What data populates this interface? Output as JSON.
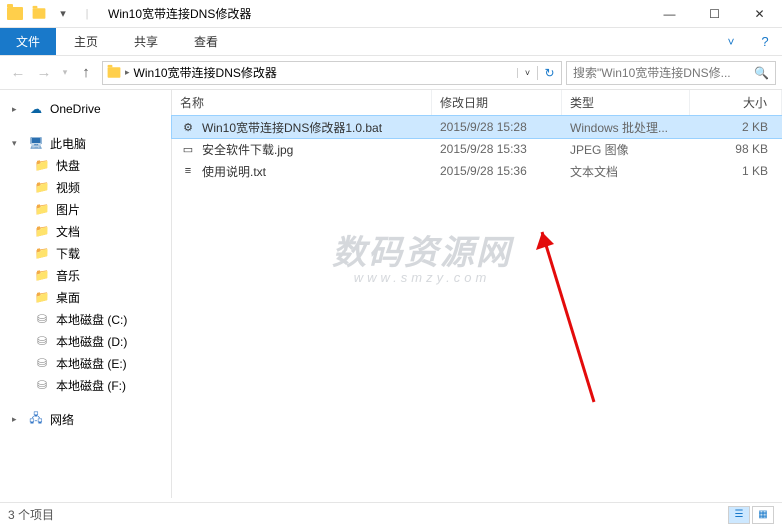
{
  "title": "Win10宽带连接DNS修改器",
  "ribbon": {
    "file": "文件",
    "tabs": [
      "主页",
      "共享",
      "查看"
    ]
  },
  "address": {
    "path": "Win10宽带连接DNS修改器"
  },
  "search": {
    "placeholder": "搜索\"Win10宽带连接DNS修..."
  },
  "navpane": {
    "onedrive": "OneDrive",
    "thispc": "此电脑",
    "children": [
      {
        "icon": "ico-green",
        "label": "快盘"
      },
      {
        "icon": "ico-video",
        "label": "视频"
      },
      {
        "icon": "ico-pic",
        "label": "图片"
      },
      {
        "icon": "ico-doc",
        "label": "文档"
      },
      {
        "icon": "ico-down",
        "label": "下载"
      },
      {
        "icon": "ico-music",
        "label": "音乐"
      },
      {
        "icon": "ico-desk",
        "label": "桌面"
      },
      {
        "icon": "ico-disk",
        "label": "本地磁盘 (C:)"
      },
      {
        "icon": "ico-disk",
        "label": "本地磁盘 (D:)"
      },
      {
        "icon": "ico-disk",
        "label": "本地磁盘 (E:)"
      },
      {
        "icon": "ico-disk",
        "label": "本地磁盘 (F:)"
      }
    ],
    "network": "网络"
  },
  "columns": {
    "name": "名称",
    "date": "修改日期",
    "type": "类型",
    "size": "大小"
  },
  "files": [
    {
      "name": "Win10宽带连接DNS修改器1.0.bat",
      "date": "2015/9/28 15:28",
      "type": "Windows 批处理...",
      "size": "2 KB",
      "ico": "⚙",
      "selected": true
    },
    {
      "name": "安全软件下载.jpg",
      "date": "2015/9/28 15:33",
      "type": "JPEG 图像",
      "size": "98 KB",
      "ico": "▭",
      "selected": false
    },
    {
      "name": "使用说明.txt",
      "date": "2015/9/28 15:36",
      "type": "文本文档",
      "size": "1 KB",
      "ico": "≡",
      "selected": false
    }
  ],
  "status": {
    "count": "3 个项目"
  },
  "watermark": {
    "main": "数码资源网",
    "sub": "www.smzy.com"
  }
}
